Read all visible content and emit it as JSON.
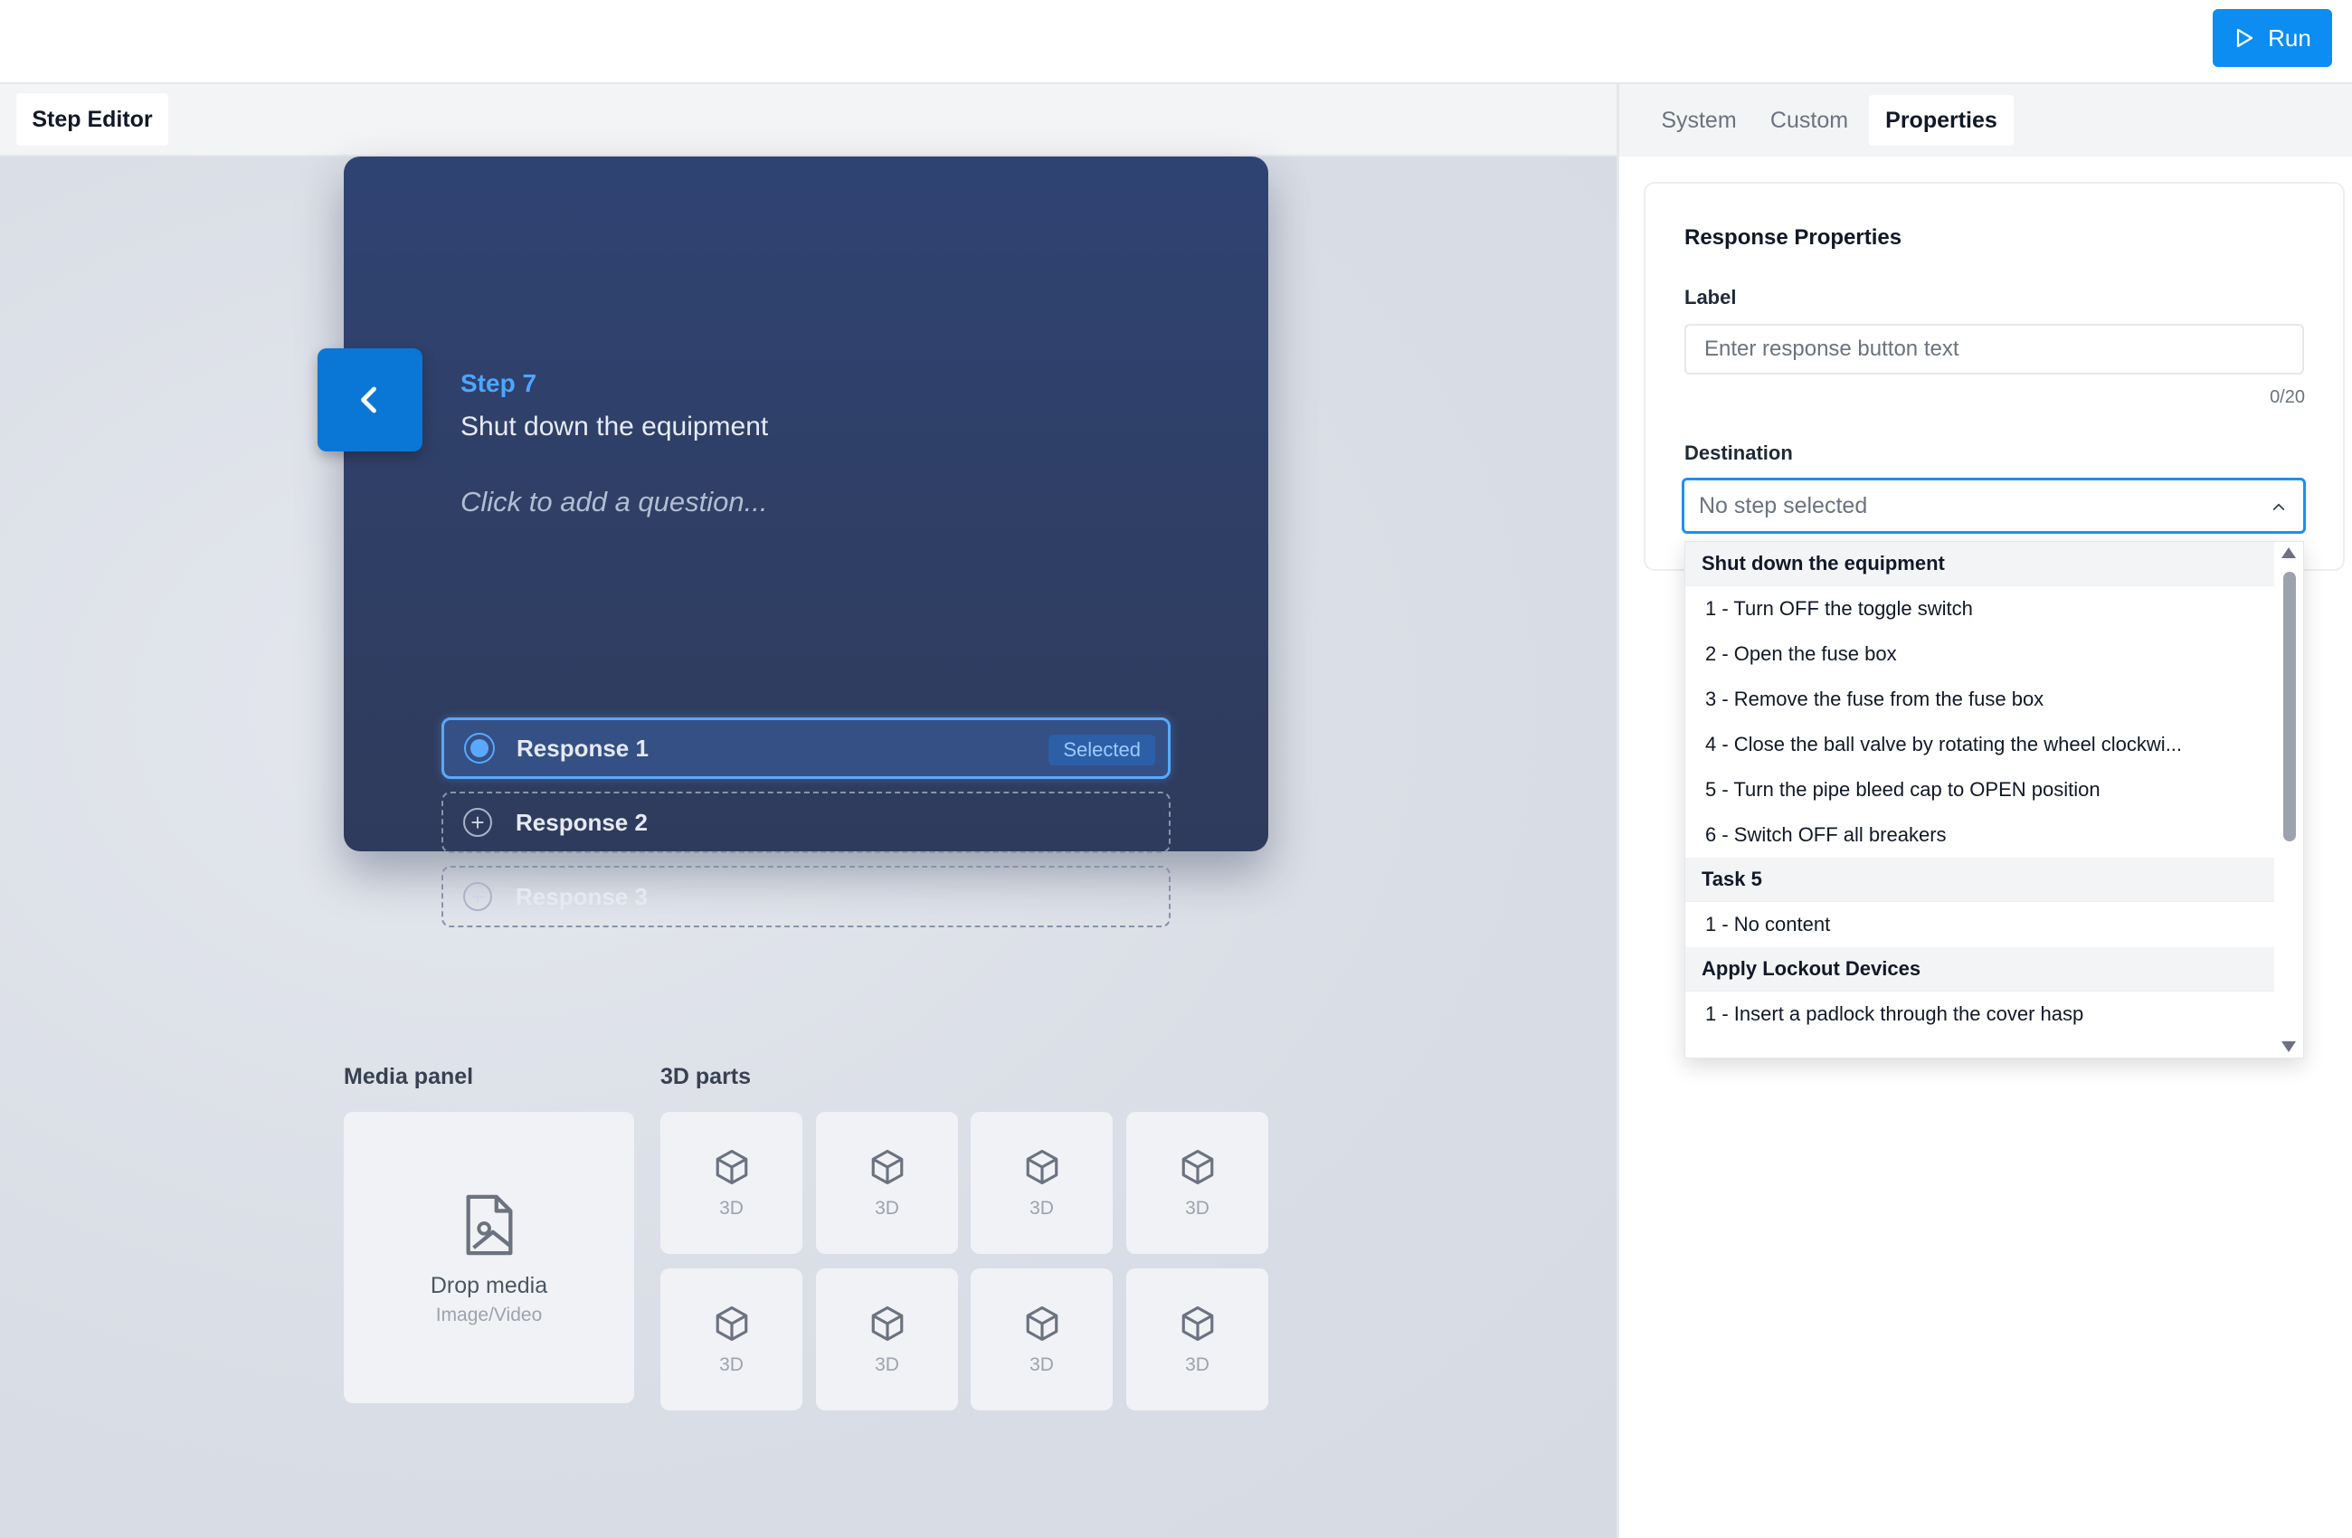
{
  "toolbar": {
    "run_label": "Run"
  },
  "left_tabs": {
    "step_editor": "Step Editor"
  },
  "step": {
    "label": "Step 7",
    "title": "Shut down the equipment",
    "question_placeholder": "Click to add a question...",
    "responses": [
      {
        "label": "Response 1",
        "badge": "Selected"
      },
      {
        "label": "Response 2"
      },
      {
        "label": "Response 3"
      }
    ]
  },
  "media_panel": {
    "title": "Media panel",
    "drop_label": "Drop media",
    "drop_hint": "Image/Video"
  },
  "parts_panel": {
    "title": "3D parts",
    "items": [
      "3D",
      "3D",
      "3D",
      "3D",
      "3D",
      "3D",
      "3D",
      "3D"
    ]
  },
  "right_tabs": [
    "System",
    "Custom",
    "Properties"
  ],
  "properties": {
    "title": "Response Properties",
    "label_field": {
      "label": "Label",
      "placeholder": "Enter response button text",
      "value": "",
      "count": "0/20"
    },
    "destination_field": {
      "label": "Destination",
      "selected": "No step selected"
    }
  },
  "dropdown": {
    "groups": [
      {
        "title": "Shut down the equipment",
        "items": [
          "1 - Turn OFF the toggle switch",
          "2 - Open the fuse box",
          "3 - Remove the fuse from the fuse box",
          "4 - Close the ball valve by rotating the wheel clockwi...",
          "5 - Turn the pipe bleed cap to OPEN position",
          "6 - Switch OFF all breakers"
        ]
      },
      {
        "title": "Task 5",
        "items": [
          "1 - No content"
        ]
      },
      {
        "title": "Apply Lockout Devices",
        "items": [
          "1 - Insert a padlock through the cover hasp"
        ]
      }
    ]
  },
  "colors": {
    "accent": "#0b8df2",
    "card_bg": "#2f4373",
    "step_label": "#4ea6ff",
    "select_border": "#1e8ff5"
  },
  "icons": {
    "run": "play-icon",
    "back": "chevron-left-icon",
    "response_selected": "radio-selected-icon",
    "response_add": "plus-circle-icon",
    "media": "image-file-icon",
    "part": "cube-icon",
    "select": "chevron-up-icon"
  }
}
